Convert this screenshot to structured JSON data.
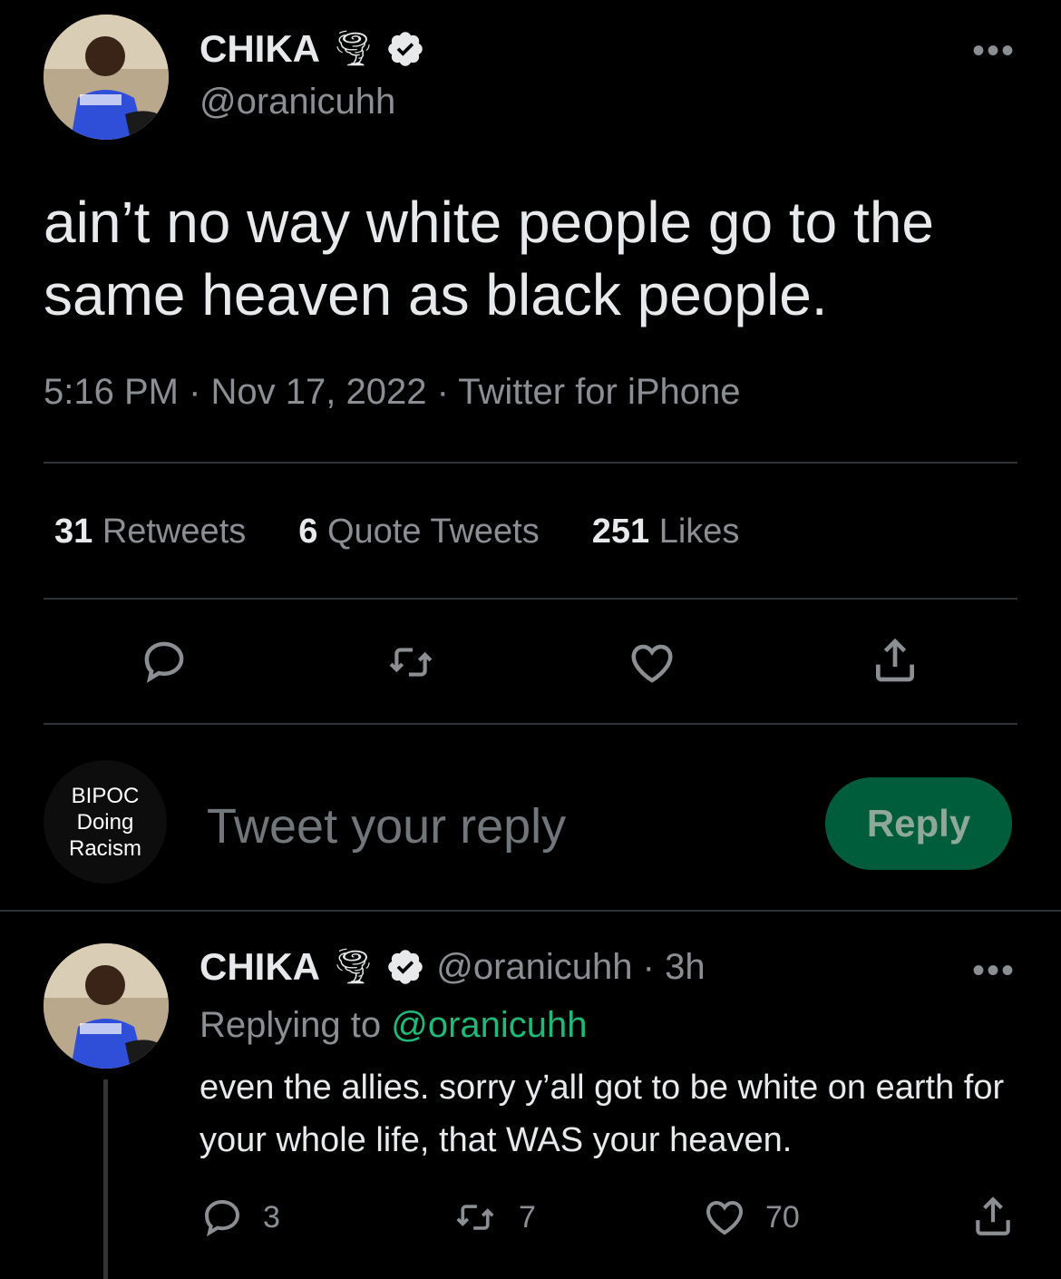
{
  "tweet": {
    "author_name": "CHIKA",
    "name_emoji": "🌪",
    "handle": "@oranicuhh",
    "text": "ain’t no way white people go to the same heaven as black people.",
    "timestamp": "5:16 PM · Nov 17, 2022 · Twitter for iPhone",
    "more_label": "•••",
    "stats": {
      "retweets_count": "31",
      "retweets_label": "Retweets",
      "quotes_count": "6",
      "quotes_label": "Quote Tweets",
      "likes_count": "251",
      "likes_label": "Likes"
    },
    "actions": [
      "reply-icon",
      "retweet-icon",
      "like-icon",
      "share-icon"
    ]
  },
  "composer": {
    "avatar_text_lines": [
      "BIPOC",
      "Doing",
      "Racism"
    ],
    "placeholder": "Tweet your reply",
    "reply_button": "Reply"
  },
  "reply_tweet": {
    "author_name": "CHIKA",
    "name_emoji": "🌪",
    "handle_time": "@oranicuhh · 3h",
    "replying_to_label": "Replying to",
    "replying_to_handle": "@oranicuhh",
    "text": "even the allies. sorry y’all got to be white on earth for your whole life, that WAS your heaven.",
    "more_label": "•••",
    "reply_count": "3",
    "retweet_count": "7",
    "like_count": "70"
  },
  "colors": {
    "background": "#000000",
    "text": "#e7e9ea",
    "secondary": "#8b8f94",
    "accent": "#1fb978",
    "reply_button_bg": "#005d3c"
  }
}
